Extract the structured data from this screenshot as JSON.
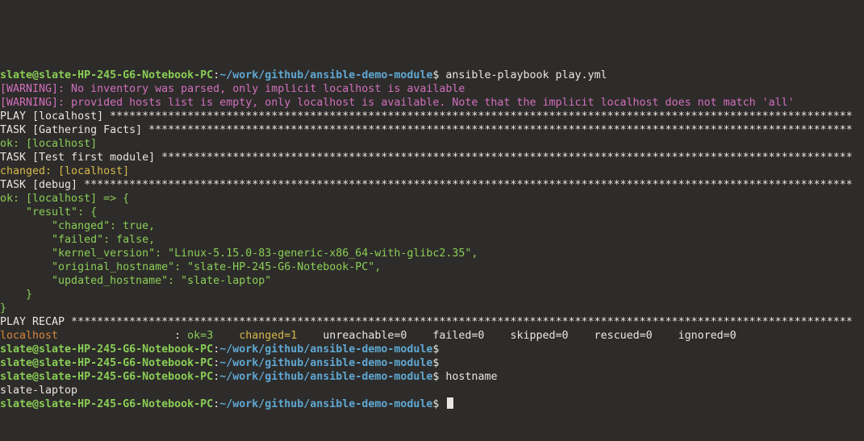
{
  "prompt": {
    "user_host": "slate@slate-HP-245-G6-Notebook-PC",
    "cwd": "~/work/github/ansible-demo-module",
    "sep1": ":",
    "dollar": "$",
    "cmd1": " ansible-playbook play.yml",
    "cmd_hostname": " hostname"
  },
  "warning1": "[WARNING]: No inventory was parsed, only implicit localhost is available",
  "warning2": "[WARNING]: provided hosts list is empty, only localhost is available. Note that the implicit localhost does not match 'all'",
  "play_header_prefix": "PLAY [localhost] ",
  "task_gather_prefix": "TASK [Gathering Facts] ",
  "task_first_prefix": "TASK [Test first module] ",
  "task_debug_prefix": "TASK [debug] ",
  "play_recap_prefix": "PLAY RECAP ",
  "ok_localhost": "ok: [localhost]",
  "changed_localhost": "changed: [localhost]",
  "debug_open": "ok: [localhost] => {",
  "debug_l1": "    \"result\": {",
  "debug_l2": "        \"changed\": true,",
  "debug_l3": "        \"failed\": false,",
  "debug_l4": "        \"kernel_version\": \"Linux-5.15.0-83-generic-x86_64-with-glibc2.35\",",
  "debug_l5": "        \"original_hostname\": \"slate-HP-245-G6-Notebook-PC\",",
  "debug_l6": "        \"updated_hostname\": \"slate-laptop\"",
  "debug_l7": "    }",
  "debug_close": "}",
  "recap_host": "localhost",
  "recap_pad": "                  : ",
  "recap_ok": "ok=3   ",
  "recap_changed": " changed=1   ",
  "recap_unreach": " unreachable=0   ",
  "recap_failed": " failed=0   ",
  "recap_skipped": " skipped=0   ",
  "recap_rescued": " rescued=0   ",
  "recap_ignored": " ignored=0   ",
  "hostname_output": "slate-laptop",
  "terminal_width": 132
}
